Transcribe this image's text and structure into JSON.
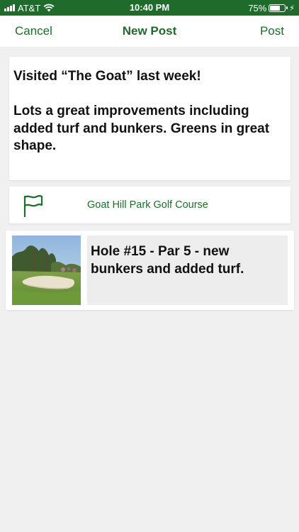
{
  "status_bar": {
    "carrier": "AT&T",
    "time": "10:40 PM",
    "battery_percent": "75%",
    "battery_level": 0.75,
    "charging_icon": "bolt-icon",
    "signal_icon": "signal-bars-icon",
    "wifi_icon": "wifi-icon"
  },
  "nav": {
    "cancel_label": "Cancel",
    "title": "New Post",
    "post_label": "Post"
  },
  "post": {
    "text": "Visited “The Goat” last week!\n\nLots a great improvements including added turf and bunkers. Greens in great shape."
  },
  "location": {
    "icon": "flag-icon",
    "name": "Goat Hill Park Golf Course"
  },
  "photo": {
    "caption": "Hole #15 - Par 5 - new bunkers and added turf."
  },
  "colors": {
    "brand_green": "#1f6b2c",
    "background": "#f0f0f0",
    "card": "#ffffff",
    "caption_background": "#ededed"
  }
}
